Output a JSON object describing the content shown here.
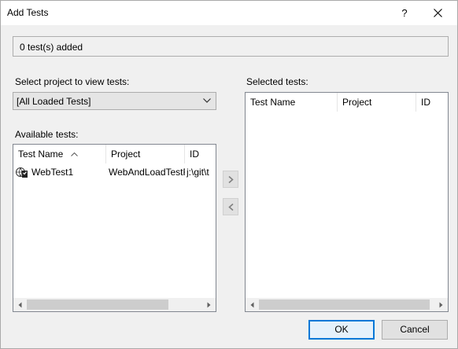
{
  "window": {
    "title": "Add Tests",
    "help_glyph": "?"
  },
  "status": {
    "text": "0 test(s) added"
  },
  "project_select": {
    "label": "Select project to view tests:",
    "selected": "[All Loaded Tests]"
  },
  "available": {
    "label": "Available tests:",
    "columns": [
      "Test Name",
      "Project",
      "ID"
    ],
    "sorted_column": "Test Name",
    "rows": [
      {
        "name": "WebTest1",
        "project": "WebAndLoadTestF",
        "id": "j:\\git\\t"
      }
    ]
  },
  "selected": {
    "label": "Selected tests:",
    "columns": [
      "Test Name",
      "Project",
      "ID"
    ],
    "rows": []
  },
  "move_buttons": {
    "add_glyph": ">",
    "remove_glyph": "<"
  },
  "buttons": {
    "ok": "OK",
    "cancel": "Cancel"
  },
  "icons": {
    "close": "close-icon",
    "dropdown": "chevron-down-icon",
    "sort": "sort-ascending-icon",
    "webtest": "web-test-icon",
    "scroll_left": "scroll-left-icon",
    "scroll_right": "scroll-right-icon"
  },
  "colors": {
    "accent": "#0078d7",
    "dialog_bg": "#f0f0f0"
  }
}
